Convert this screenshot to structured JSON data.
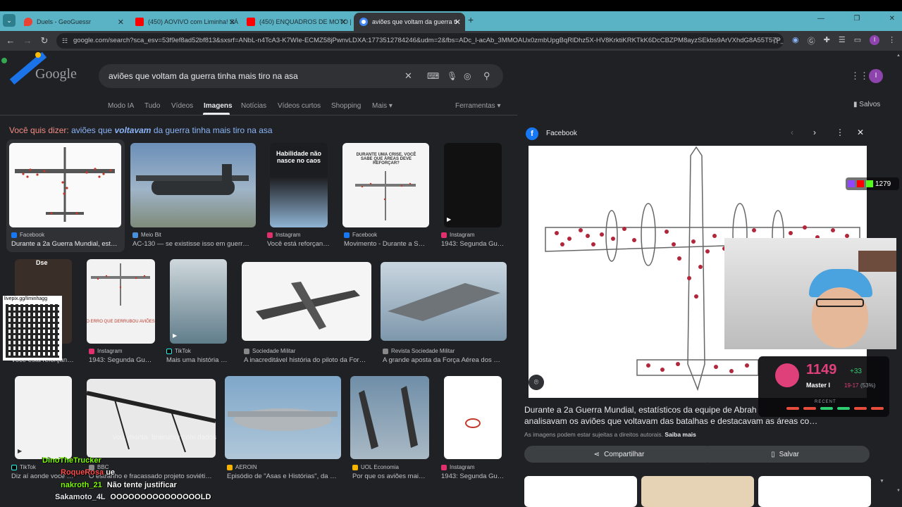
{
  "browser": {
    "tabs": [
      {
        "label": "Duels - GeoGuessr",
        "icon": "map-pin-icon",
        "color": "#ea4335"
      },
      {
        "label": "(450) AOVIVO com Liminha! SÁ",
        "icon": "youtube-icon",
        "color": "#ff0000"
      },
      {
        "label": "(450) ENQUADROS DE MOTO |",
        "icon": "youtube-icon",
        "color": "#ff0000"
      },
      {
        "label": "aviões que voltam da guerra ti",
        "icon": "google-icon",
        "color": "#4285f4"
      }
    ],
    "url": "google.com/search?sca_esv=53f9ef8ad52bf813&sxsrf=ANbL-n4TcA3-K7WIe-ECMZ58jPwnvLDXA:1773512784246&udm=2&fbs=ADc_l-acAb_3MMOAUx0zmbUpgBqRlDhz5X-HV8KrktiKRKTkK6DcCBZPM8ayzSEkbs9ArVXhdG8A55T57P_f0c..."
  },
  "google": {
    "logo": "Google",
    "query": "aviões que voltam da guerra tinha mais tiro na asa",
    "nav": [
      "Modo IA",
      "Tudo",
      "Vídeos",
      "Imagens",
      "Notícias",
      "Vídeos curtos",
      "Shopping",
      "Mais ▾"
    ],
    "tools": "Ferramentas ▾",
    "saved": "Salvos",
    "did_you_mean_prefix": "Você quis dizer:",
    "did_you_mean_a": "aviões que",
    "did_you_mean_b": "voltavam",
    "did_you_mean_c": "da guerra tinha mais tiro na asa"
  },
  "results": [
    {
      "source": "Facebook",
      "title": "Durante a 2a Guerra Mundial, est…",
      "src_color": "#1877f2"
    },
    {
      "source": "Meio Bit",
      "title": "AC-130 — se existisse isso em guerr…",
      "src_color": "#4a90d9"
    },
    {
      "source": "Instagram",
      "title": "Você está reforçan…",
      "src_color": "#e1306c",
      "overlay": "Habilidade não nasce no caos"
    },
    {
      "source": "Facebook",
      "title": "Movimento - Durante a S…",
      "src_color": "#1877f2",
      "overlay": "DURANTE UMA CRISE, VOCÊ SABE QUE ÁREAS DEVE REFORÇAR?"
    },
    {
      "source": "Instagram",
      "title": "1943: Segunda Gu…",
      "src_color": "#e1306c"
    },
    {
      "source": "",
      "title": "Você está reforçan…",
      "src_color": "#e1306c",
      "overlay": "Dse"
    },
    {
      "source": "Instagram",
      "title": "1943: Segunda Gu…",
      "src_color": "#e1306c"
    },
    {
      "source": "TikTok",
      "title": "Mais uma história …",
      "src_color": "#000000"
    },
    {
      "source": "Sociedade Militar",
      "title": "A inacreditável história do piloto da For…",
      "src_color": "#888888"
    },
    {
      "source": "Revista Sociedade Militar",
      "title": "A grande aposta da Força Aérea dos …",
      "src_color": "#888888"
    },
    {
      "source": "TikTok",
      "title": "Diz aí aonde você …",
      "src_color": "#000000"
    },
    {
      "source": "BBC",
      "title": "O estranho e fracassado projeto soviéti…",
      "src_color": "#888888"
    },
    {
      "source": "AEROIN",
      "title": "Episódio de \"Asas e Histórias\", da …",
      "src_color": "#f4b400"
    },
    {
      "source": "UOL Economia",
      "title": "Por que os aviões mai…",
      "src_color": "#f4b400"
    },
    {
      "source": "Instagram",
      "title": "1943: Segunda Gu…",
      "src_color": "#e1306c"
    }
  ],
  "panel": {
    "source": "Facebook",
    "title": "Durante a 2a Guerra Mundial, estatísticos da equipe de Abrah… analisavam os aviões que voltavam das batalhas e destacavam as áreas co…",
    "title_line1": "Durante a 2a Guerra Mundial, estatísticos da equipe de Abrah",
    "title_line2": "analisavam os aviões que voltavam das batalhas e destacavam as áreas co…",
    "rights": "As imagens podem estar sujeitas a direitos autorais.",
    "learn_more": "Saiba mais",
    "share": "Compartilhar",
    "save": "Salvar"
  },
  "stream": {
    "follower_badge": "1279",
    "qr_label": "livepix.gg/liminhagg",
    "rank_score": "1149",
    "rank_delta": "+33",
    "rank_name": "Master I",
    "rank_record": "19-17",
    "rank_pct": "(53%)",
    "rank_recent": "RECENT",
    "chat": [
      {
        "user": "DinoTheTrucker",
        "msg": "",
        "color": "#7cfc00"
      },
      {
        "user": "RoqueRosa",
        "msg": "ue",
        "color": "#ff4d4d"
      },
      {
        "user": "nakroth_21",
        "msg": "Não tente justificar",
        "color": "#7cfc00"
      },
      {
        "user": "Sakamoto_4L",
        "msg": "OOOOOOOOOOOOOOOLD",
        "color": "#e8eaed"
      }
    ],
    "chat_faded": "vou, monta, brainatsy com dados"
  }
}
